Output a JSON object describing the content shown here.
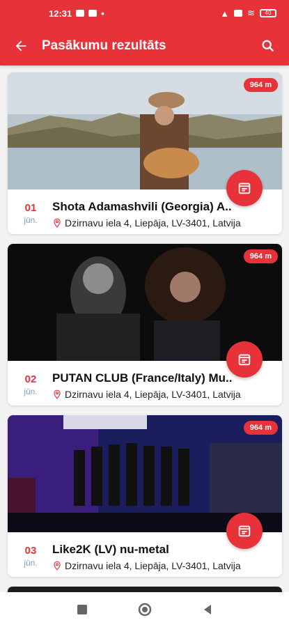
{
  "status_bar": {
    "time": "12:31",
    "battery": "40"
  },
  "app_bar": {
    "title": "Pasākumu rezultāts"
  },
  "colors": {
    "accent": "#e8323a",
    "month": "#7aa0c4"
  },
  "events": [
    {
      "distance": "964 m",
      "day": "01",
      "month": "jūn.",
      "title": "Shota Adamashvili (Georgia) A..",
      "address": "Dzirnavu iela 4, Liepāja, LV-3401, Latvija"
    },
    {
      "distance": "964 m",
      "day": "02",
      "month": "jūn.",
      "title": "PUTAN CLUB (France/Italy) Mu..",
      "address": "Dzirnavu iela 4, Liepāja, LV-3401, Latvija"
    },
    {
      "distance": "964 m",
      "day": "03",
      "month": "jūn.",
      "title": "Like2K (LV) nu-metal",
      "address": "Dzirnavu iela 4, Liepāja, LV-3401, Latvija"
    }
  ]
}
